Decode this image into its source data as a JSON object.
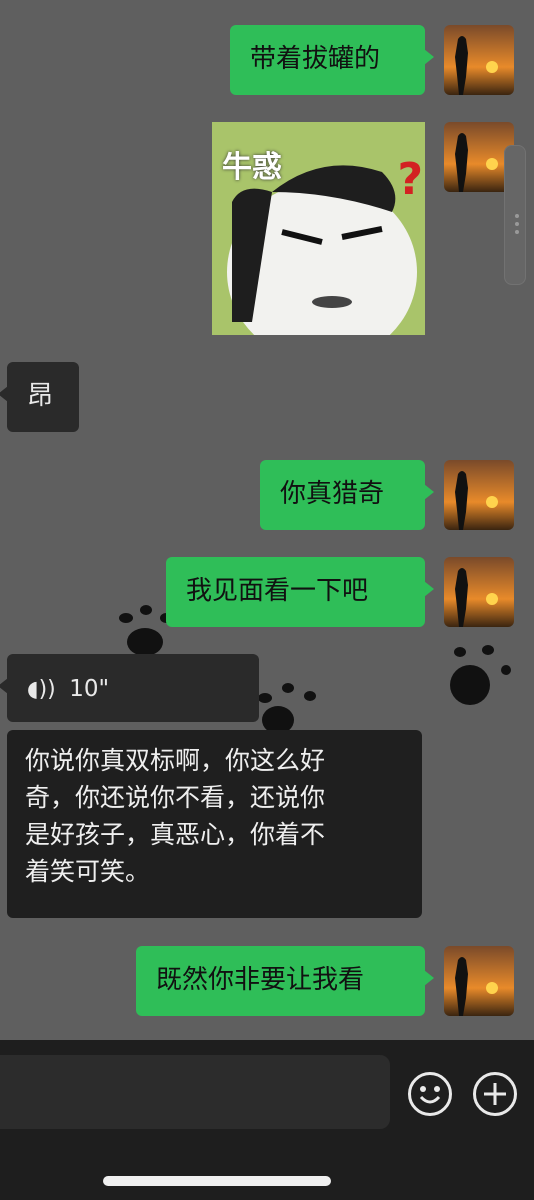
{
  "messages": [
    {
      "side": "me",
      "text": "带着拔罐的"
    },
    {
      "side": "me",
      "type": "sticker",
      "caption": "牛惑"
    },
    {
      "side": "them",
      "text": "昂"
    },
    {
      "side": "me",
      "text": "你真猎奇"
    },
    {
      "side": "me",
      "text": "我见面看一下吧"
    },
    {
      "side": "them",
      "type": "voice",
      "duration": "10\""
    },
    {
      "side": "them",
      "text": "你说你真双标啊，你这么好奇，你还说你不看，还说你是好孩子，真恶心，你着不着笑可笑。"
    },
    {
      "side": "me",
      "text": "既然你非要让我看"
    }
  ],
  "transcription": {
    "lines": [
      "你说你真双标啊，你这么好",
      "奇，你还说你不看，还说你",
      "是好孩子，真恶心，你着不",
      "着笑可笑。"
    ]
  },
  "colors": {
    "me_bubble": "#2fbe58",
    "them_bubble": "#2a2a2a",
    "background": "#5f5f5f",
    "bottom_bar": "#1e1e1e"
  },
  "icons": {
    "voice": "voice-wave-icon",
    "emoji": "emoji-icon",
    "plus": "plus-icon"
  }
}
